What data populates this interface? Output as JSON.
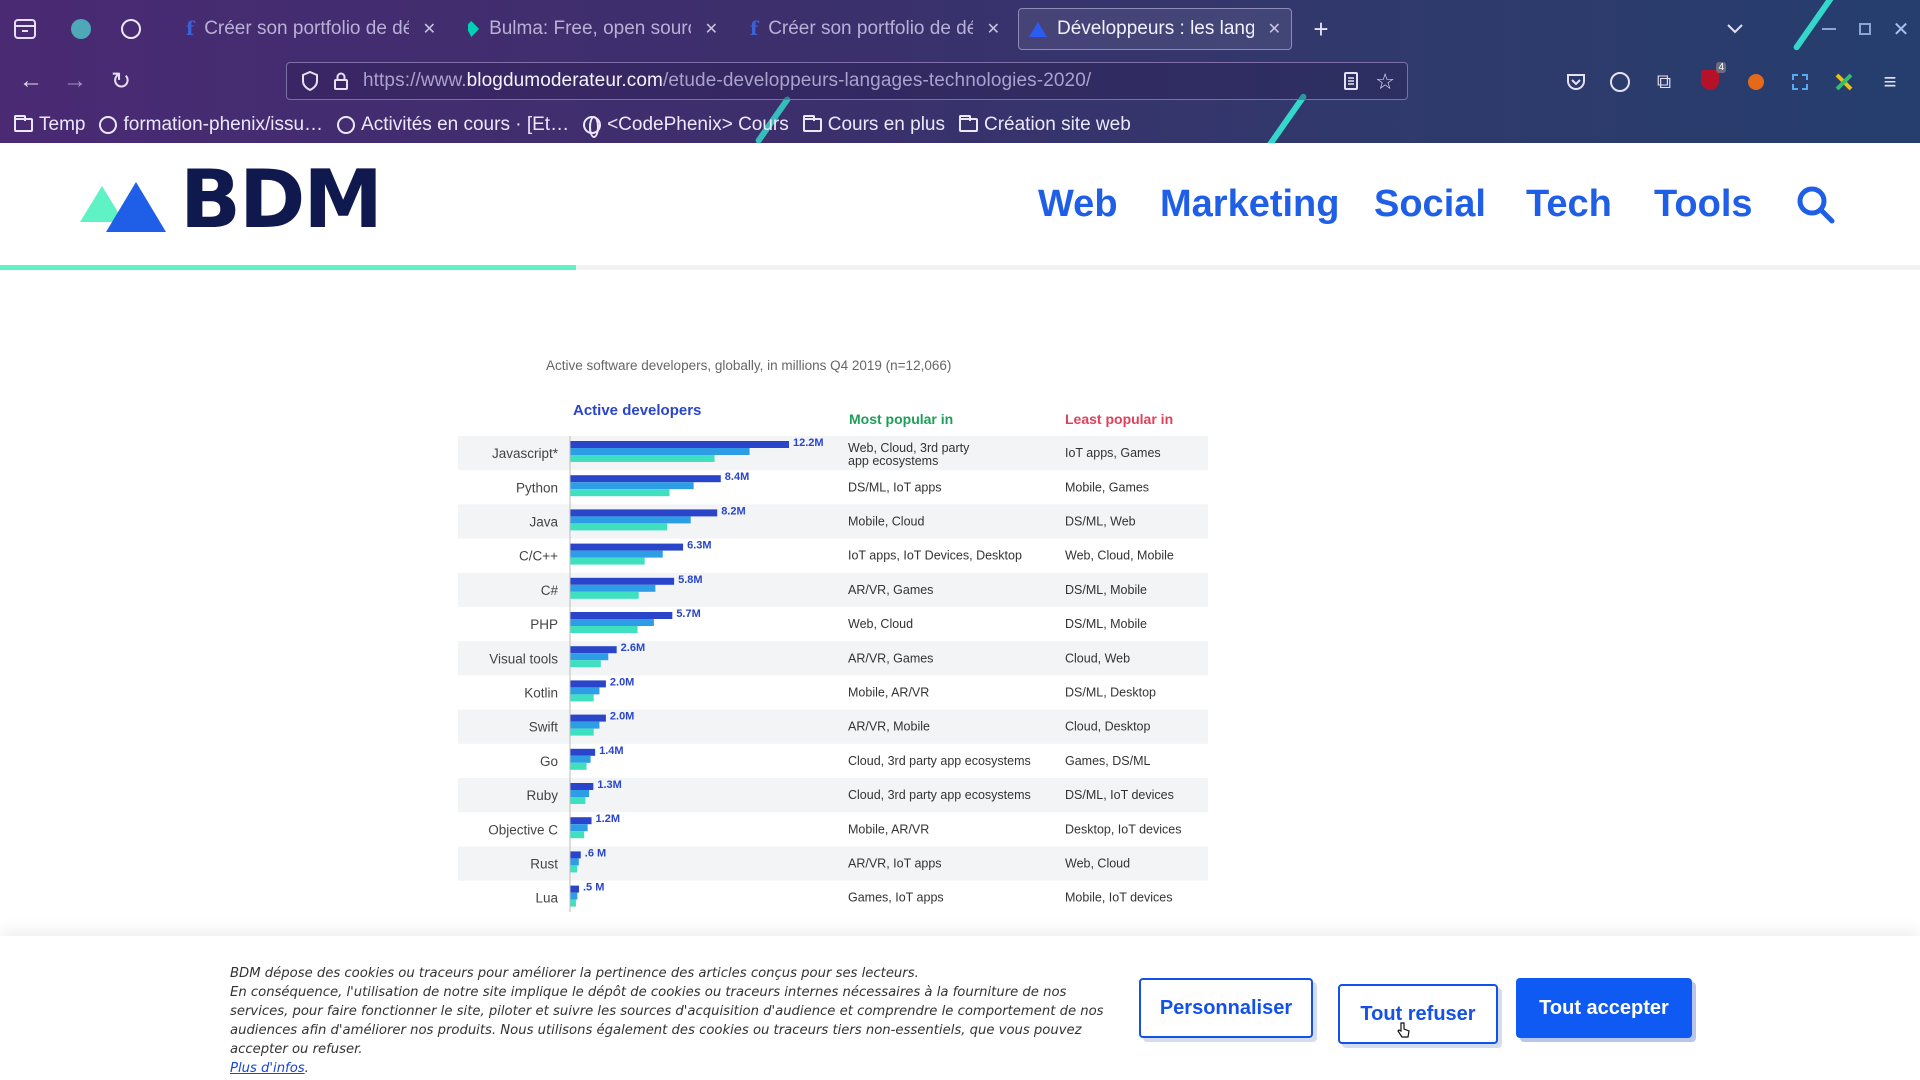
{
  "browser": {
    "tabs": [
      {
        "title": "Créer son portfolio de dé",
        "active": false,
        "favicon": "facebook-f-icon"
      },
      {
        "title": "Bulma: Free, open source",
        "active": false,
        "favicon": "bulma-icon"
      },
      {
        "title": "Créer son portfolio de dé",
        "active": false,
        "favicon": "facebook-f-icon"
      },
      {
        "title": "Développeurs : les langag",
        "active": true,
        "favicon": "bdm-icon"
      }
    ],
    "url": {
      "prefix": "https://www.",
      "host": "blogdumoderateur.com",
      "path": "/etude-developpeurs-langages-technologies-2020/"
    },
    "extension_badge": "4",
    "bookmarks": [
      {
        "label": "Temp",
        "icon": "folder-icon"
      },
      {
        "label": "formation-phenix/issu…",
        "icon": "github-icon"
      },
      {
        "label": "Activités en cours · [Et…",
        "icon": "github-icon"
      },
      {
        "label": "<CodePhenix> Cours",
        "icon": "globe-icon"
      },
      {
        "label": "Cours en plus",
        "icon": "folder-icon"
      },
      {
        "label": "Création site web",
        "icon": "folder-icon"
      }
    ]
  },
  "site": {
    "logo_text": "BDM",
    "nav": [
      "Web",
      "Marketing",
      "Social",
      "Tech",
      "Tools"
    ],
    "reading_progress": 0.3,
    "colors": {
      "brand_blue": "#1f5ee6",
      "brand_navy": "#10194d",
      "accent_mint": "#5ef2c4"
    }
  },
  "chart_data": {
    "type": "bar",
    "subtitle": "Active software developers, globally, in millions Q4 2019 (n=12,066)",
    "bar_header": "Active developers",
    "popular_header": "Most popular in",
    "least_header": "Least popular in",
    "categories": [
      "Javascript*",
      "Python",
      "Java",
      "C/C++",
      "C#",
      "PHP",
      "Visual tools",
      "Kotlin",
      "Swift",
      "Go",
      "Ruby",
      "Objective C",
      "Rust",
      "Lua"
    ],
    "values": [
      12.2,
      8.4,
      8.2,
      6.3,
      5.8,
      5.7,
      2.6,
      2.0,
      2.0,
      1.4,
      1.3,
      1.2,
      0.6,
      0.5
    ],
    "value_labels": [
      "12.2M",
      "8.4M",
      "8.2M",
      "6.3M",
      "5.8M",
      "5.7M",
      "2.6M",
      "2.0M",
      "2.0M",
      "1.4M",
      "1.3M",
      "1.2M",
      ".6 M",
      ".5 M"
    ],
    "most_popular_in": [
      "Web, Cloud, 3rd party app ecosystems",
      "DS/ML, IoT apps",
      "Mobile, Cloud",
      "IoT apps, IoT Devices, Desktop",
      "AR/VR, Games",
      "Web, Cloud",
      "AR/VR, Games",
      "Mobile, AR/VR",
      "AR/VR, Mobile",
      "Cloud, 3rd party app ecosystems",
      "Cloud, 3rd party app ecosystems",
      "Mobile, AR/VR",
      "AR/VR, IoT apps",
      "Games, IoT apps"
    ],
    "least_popular_in": [
      "IoT apps, Games",
      "Mobile, Games",
      "DS/ML, Web",
      "Web, Cloud, Mobile",
      "DS/ML, Mobile",
      "DS/ML, Mobile",
      "Cloud, Web",
      "DS/ML, Desktop",
      "Cloud, Desktop",
      "Games, DS/ML",
      "DS/ML, IoT devices",
      "Desktop, IoT devices",
      "Web, Cloud",
      "Mobile, IoT devices"
    ],
    "colors": {
      "bar_dark": "#2a45c9",
      "bar_mid": "#2d9de6",
      "bar_light": "#3ee0c0",
      "most_header": "#1e9e5a",
      "least_header": "#e0405a",
      "bar_header": "#2a45c9"
    }
  },
  "cookie": {
    "line1": "BDM dépose des cookies ou traceurs pour améliorer la pertinence des articles conçus pour ses lecteurs.",
    "line2": "En conséquence, l'utilisation de notre site implique le dépôt de cookies ou traceurs internes nécessaires à la fourniture de nos services, pour faire fonctionner le site, piloter et suivre les sources d'acquisition d'audience et comprendre le comportement de nos audiences afin d'améliorer nos produits. Nous utilisons également des cookies ou traceurs tiers non-essentiels, que vous pouvez accepter ou refuser.",
    "more_link": "Plus d'infos",
    "personalize": "Personnaliser",
    "refuse": "Tout refuser",
    "accept": "Tout accepter"
  }
}
